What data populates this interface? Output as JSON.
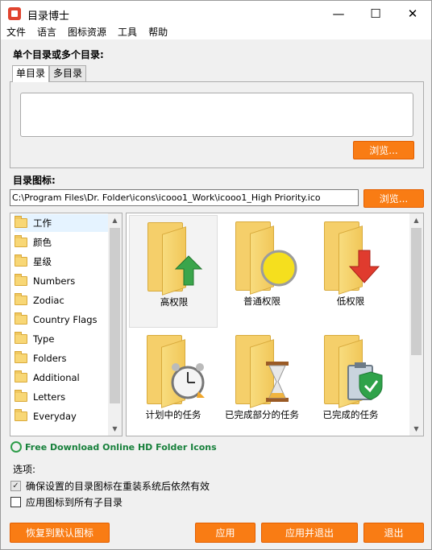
{
  "window": {
    "title": "目录博士"
  },
  "menu": [
    "文件",
    "语言",
    "图标资源",
    "工具",
    "帮助"
  ],
  "section_single": "单个目录或多个目录:",
  "tabs": [
    "单目录",
    "多目录"
  ],
  "browse_label": "浏览...",
  "section_icon": "目录图标:",
  "icon_path": "C:\\Program Files\\Dr. Folder\\icons\\icooo1_Work\\icooo1_High Priority.ico",
  "categories": [
    "工作",
    "颜色",
    "星级",
    "Numbers",
    "Zodiac",
    "Country Flags",
    "Type",
    "Folders",
    "Additional",
    "Letters",
    "Everyday"
  ],
  "icons": [
    {
      "label": "高权限",
      "overlay": "up-arrow-icon"
    },
    {
      "label": "普通权限",
      "overlay": "circle-icon"
    },
    {
      "label": "低权限",
      "overlay": "down-arrow-icon"
    },
    {
      "label": "计划中的任务",
      "overlay": "alarm-clock-icon"
    },
    {
      "label": "已完成部分的任务",
      "overlay": "hourglass-icon"
    },
    {
      "label": "已完成的任务",
      "overlay": "clipboard-check-icon"
    }
  ],
  "download_link": "Free Download Online HD Folder Icons",
  "options": {
    "title": "选项:",
    "keep_icon": {
      "label": "确保设置的目录图标在重装系统后依然有效",
      "checked": true
    },
    "apply_subfolders": {
      "label": "应用图标到所有子目录",
      "checked": false
    }
  },
  "buttons": {
    "restore": "恢复到默认图标",
    "apply": "应用",
    "apply_exit": "应用并退出",
    "exit": "退出"
  },
  "colors": {
    "accent": "#f97c14",
    "link": "#17803b"
  }
}
